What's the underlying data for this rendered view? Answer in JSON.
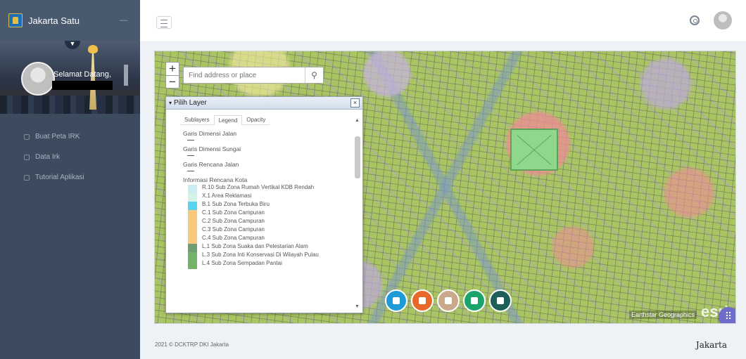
{
  "sidebar": {
    "app_title": "Jakarta Satu",
    "greeting": "Selamat Datang,",
    "items": [
      {
        "label": "Buat Peta IRK",
        "icon": "map-icon"
      },
      {
        "label": "Data Irk",
        "icon": "list-icon"
      },
      {
        "label": "Tutorial Aplikasi",
        "icon": "info-icon"
      }
    ]
  },
  "topbar": {
    "icons": [
      "menu-icon",
      "gear-icon",
      "avatar"
    ]
  },
  "map": {
    "search": {
      "placeholder": "Find address or place",
      "button_icon": "search-icon"
    },
    "zoom": {
      "in": "+",
      "out": "−"
    },
    "layer_panel": {
      "title": "Pilih Layer",
      "close": "×",
      "tabs": [
        "Sublayers",
        "Legend",
        "Opacity"
      ],
      "active_tab": "Legend",
      "legend": {
        "line_groups": [
          "Garis Dimensi Jalan",
          "Garis Dimensi Sungai",
          "Garis Rencana Jalan"
        ],
        "group_title": "Informasi Rencana Kota",
        "rows": [
          {
            "label": "R.10 Sub Zona Rumah Vertikal KDB Rendah",
            "color": "#c9edf0"
          },
          {
            "label": "X.1 Area Reklamasi",
            "color": "#d5f2e6"
          },
          {
            "label": "B.1 Sub Zona Terbuka Biru",
            "color": "#5ad3f1"
          },
          {
            "label": "C.1 Sub Zona Campuran",
            "color": "#f6c97d"
          },
          {
            "label": "C.2 Sub Zona Campuran",
            "color": "#f6c97d"
          },
          {
            "label": "C.3 Sub Zona Campuran",
            "color": "#f6c97d"
          },
          {
            "label": "C.4 Sub Zona Campuran",
            "color": "#f6c97d"
          },
          {
            "label": "L.1 Sub Zona Suaka dan Pelestarian Alam",
            "color": "#6f9e73"
          },
          {
            "label": "L.3 Sub Zona Inti Konservasi Di Wilayah Pulau",
            "color": "#74b268"
          },
          {
            "label": "L.4 Sub Zona Sempadan Pantai",
            "color": "#74b268"
          }
        ]
      }
    },
    "tools": [
      {
        "name": "layers-tool",
        "color": "#1e9bd7"
      },
      {
        "name": "basemap-tool",
        "color": "#e8672a"
      },
      {
        "name": "draw-tool",
        "color": "#c9a88c"
      },
      {
        "name": "export-tool",
        "color": "#1aa36a"
      },
      {
        "name": "print-tool",
        "color": "#1c5e58"
      }
    ],
    "attribution": "Earthstar Geographics",
    "esri_logo": "esri",
    "apps_icon": "⠿"
  },
  "footer": {
    "copyright": "2021 © DCKTRP DKI Jakarta",
    "brand": "Jakarta"
  }
}
